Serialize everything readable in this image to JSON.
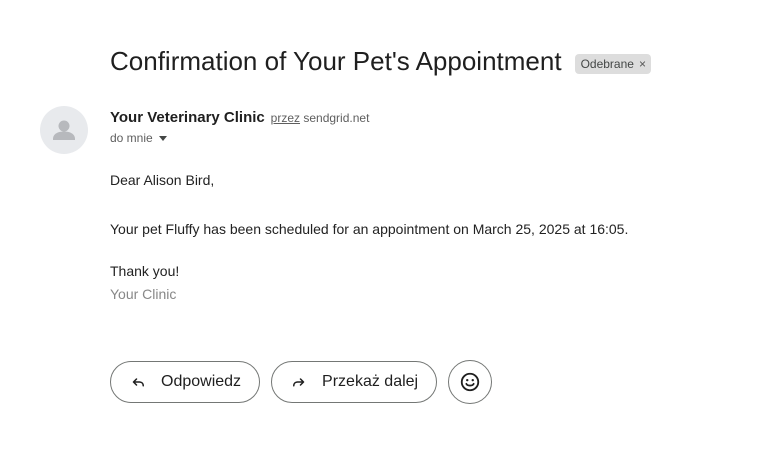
{
  "email": {
    "subject": "Confirmation of Your Pet's Appointment",
    "label": "Odebrane",
    "label_remove": "×",
    "sender": {
      "name": "Your Veterinary Clinic",
      "via_word": "przez",
      "via_domain": "sendgrid.net",
      "recipient": "do mnie"
    },
    "body": {
      "greeting": "Dear Alison Bird,",
      "main": "Your pet Fluffy has been scheduled for an appointment on March 25, 2025 at 16:05.",
      "thanks": "Thank you!",
      "signature": "Your Clinic"
    }
  },
  "actions": {
    "reply_label": "Odpowiedz",
    "forward_label": "Przekaż dalej"
  },
  "icons": {
    "avatar": "person-icon",
    "reply": "reply-icon",
    "forward": "forward-icon",
    "emoji": "smiley-icon",
    "details": "chevron-down-icon"
  }
}
